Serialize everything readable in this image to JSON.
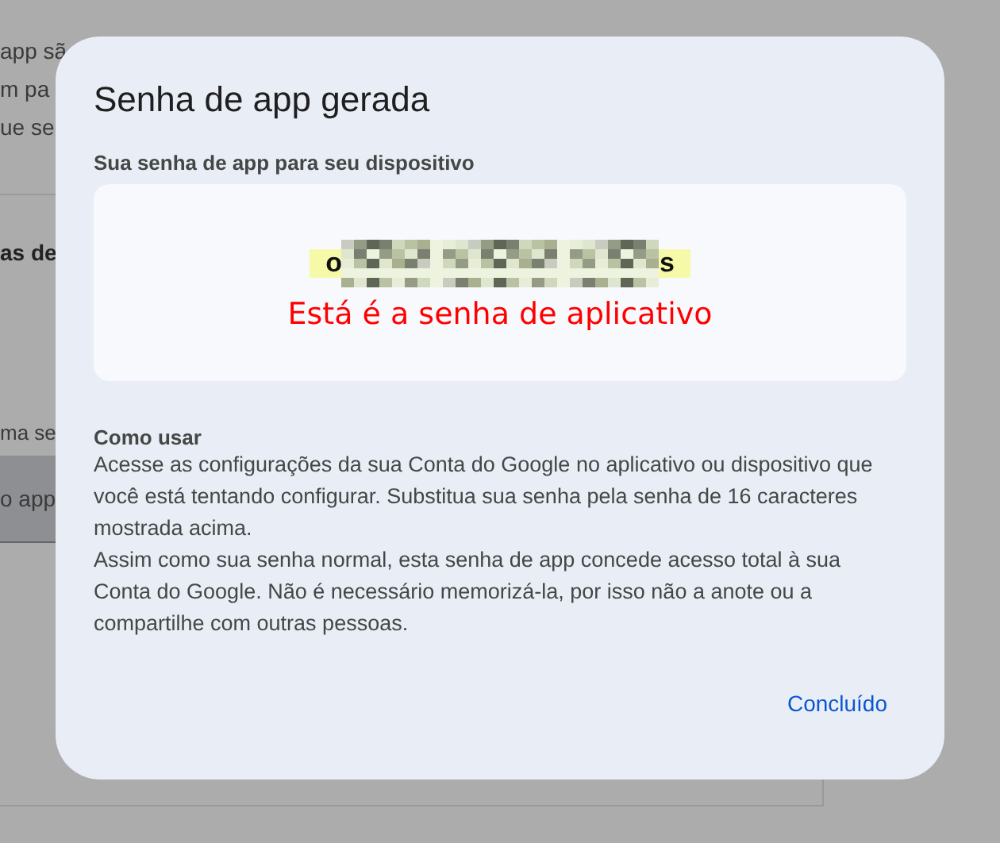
{
  "background_page": {
    "lines": [
      "app sã",
      "m pa",
      "ue se"
    ],
    "heading": "as de",
    "label": "ma se",
    "button": "o app"
  },
  "dialog": {
    "title": "Senha de app gerada",
    "password_label": "Sua senha de app para seu dispositivo",
    "password": {
      "first": "o",
      "last": "s",
      "annotation": "Está é a senha de aplicativo"
    },
    "how_to": {
      "heading": "Como usar",
      "paragraphs": [
        "Acesse as configurações da sua Conta do Google no aplicativo ou dispositivo que você está tentando configurar. Substitua sua senha pela senha de 16 caracteres mostrada acima.",
        "Assim como sua senha normal, esta senha de app concede acesso total à sua Conta do Google. Não é necessário memorizá-la, por isso não a anote ou a compartilhe com outras pessoas."
      ]
    },
    "done_button": "Concluído"
  }
}
